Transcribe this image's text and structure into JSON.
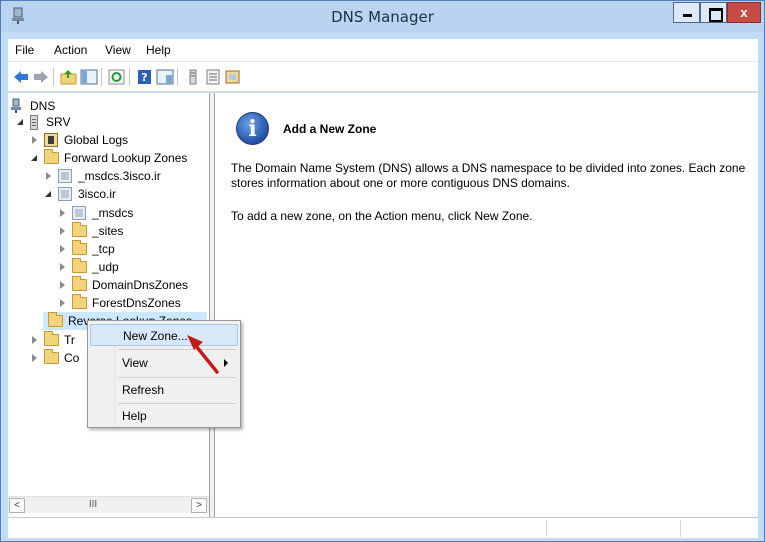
{
  "window": {
    "title": "DNS Manager",
    "close_glyph": "x"
  },
  "menu": {
    "items": [
      "File",
      "Action",
      "View",
      "Help"
    ]
  },
  "toolbar": {
    "icons": [
      "back-arrow-icon",
      "forward-arrow-icon",
      "up-folder-icon",
      "show-hide-tree-icon",
      "refresh-icon",
      "help-icon",
      "properties-icon",
      "server-icon",
      "list-icon",
      "zone-icon"
    ]
  },
  "tree": {
    "root": "DNS",
    "server": "SRV",
    "global_logs": "Global Logs",
    "forward_zones": "Forward Lookup Zones",
    "msdcs_zone": "_msdcs.3isco.ir",
    "zone_3isco": "3isco.ir",
    "sub_msdcs": "_msdcs",
    "sub_sites": "_sites",
    "sub_tcp": "_tcp",
    "sub_udp": "_udp",
    "domain_dns_zones": "DomainDnsZones",
    "forest_dns_zones": "ForestDnsZones",
    "reverse_zones": "Reverse Lookup Zones",
    "trust_points_partial": "Tr",
    "conditional_partial": "Co"
  },
  "scrollbar": {
    "thumb": "III",
    "left": "<",
    "right": ">"
  },
  "result": {
    "heading": "Add a New Zone",
    "para1_line1": "The Domain Name System (DNS) allows a DNS namespace to be divided into zones. Each zone",
    "para1_line2": "stores information about one or more contiguous DNS domains.",
    "para2": "To add a new zone, on the Action menu, click New Zone."
  },
  "context_menu": {
    "items": [
      "New Zone...",
      "View",
      "Refresh",
      "Help"
    ]
  },
  "colors": {
    "accent_arrow": "#c41b1b",
    "selection": "#cce8ff",
    "titlebar": "#b9d4f0"
  }
}
